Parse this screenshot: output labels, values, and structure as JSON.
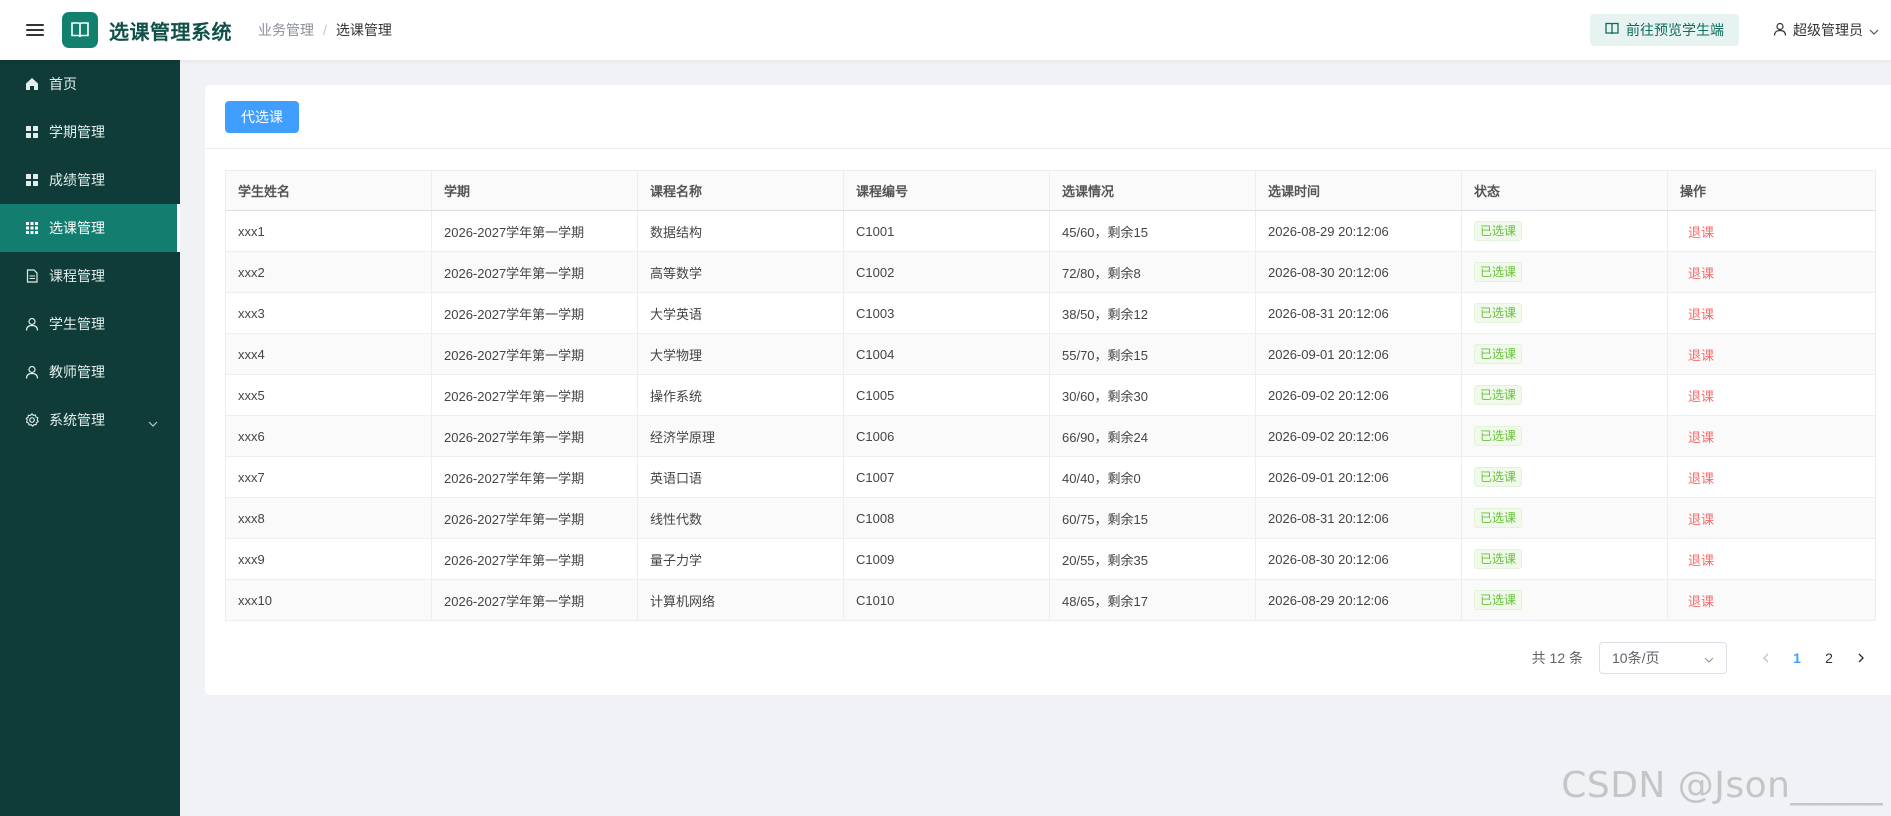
{
  "header": {
    "app_title": "选课管理系统",
    "breadcrumb": [
      "业务管理",
      "选课管理"
    ],
    "preview_label": "前往预览学生端",
    "user_label": "超级管理员"
  },
  "sidebar": {
    "items": [
      {
        "label": "首页",
        "icon": "home-icon"
      },
      {
        "label": "学期管理",
        "icon": "grid-icon"
      },
      {
        "label": "成绩管理",
        "icon": "grid-icon"
      },
      {
        "label": "选课管理",
        "icon": "apps-icon",
        "active": true
      },
      {
        "label": "课程管理",
        "icon": "document-icon"
      },
      {
        "label": "学生管理",
        "icon": "user-icon"
      },
      {
        "label": "教师管理",
        "icon": "user-icon"
      },
      {
        "label": "系统管理",
        "icon": "gear-icon"
      }
    ]
  },
  "toolbar": {
    "proxy_select_label": "代选课"
  },
  "table": {
    "headers": [
      "学生姓名",
      "学期",
      "课程名称",
      "课程编号",
      "选课情况",
      "选课时间",
      "状态",
      "操作"
    ],
    "rows": [
      {
        "name": "xxx1",
        "term": "2026-2027学年第一学期",
        "course": "数据结构",
        "code": "C1001",
        "status_info": "45/60，剩余15",
        "time": "2026-08-29 20:12:06",
        "state": "已选课",
        "action": "退课"
      },
      {
        "name": "xxx2",
        "term": "2026-2027学年第一学期",
        "course": "高等数学",
        "code": "C1002",
        "status_info": "72/80，剩余8",
        "time": "2026-08-30 20:12:06",
        "state": "已选课",
        "action": "退课"
      },
      {
        "name": "xxx3",
        "term": "2026-2027学年第一学期",
        "course": "大学英语",
        "code": "C1003",
        "status_info": "38/50，剩余12",
        "time": "2026-08-31 20:12:06",
        "state": "已选课",
        "action": "退课"
      },
      {
        "name": "xxx4",
        "term": "2026-2027学年第一学期",
        "course": "大学物理",
        "code": "C1004",
        "status_info": "55/70，剩余15",
        "time": "2026-09-01 20:12:06",
        "state": "已选课",
        "action": "退课"
      },
      {
        "name": "xxx5",
        "term": "2026-2027学年第一学期",
        "course": "操作系统",
        "code": "C1005",
        "status_info": "30/60，剩余30",
        "time": "2026-09-02 20:12:06",
        "state": "已选课",
        "action": "退课"
      },
      {
        "name": "xxx6",
        "term": "2026-2027学年第一学期",
        "course": "经济学原理",
        "code": "C1006",
        "status_info": "66/90，剩余24",
        "time": "2026-09-02 20:12:06",
        "state": "已选课",
        "action": "退课"
      },
      {
        "name": "xxx7",
        "term": "2026-2027学年第一学期",
        "course": "英语口语",
        "code": "C1007",
        "status_info": "40/40，剩余0",
        "time": "2026-09-01 20:12:06",
        "state": "已选课",
        "action": "退课"
      },
      {
        "name": "xxx8",
        "term": "2026-2027学年第一学期",
        "course": "线性代数",
        "code": "C1008",
        "status_info": "60/75，剩余15",
        "time": "2026-08-31 20:12:06",
        "state": "已选课",
        "action": "退课"
      },
      {
        "name": "xxx9",
        "term": "2026-2027学年第一学期",
        "course": "量子力学",
        "code": "C1009",
        "status_info": "20/55，剩余35",
        "time": "2026-08-30 20:12:06",
        "state": "已选课",
        "action": "退课"
      },
      {
        "name": "xxx10",
        "term": "2026-2027学年第一学期",
        "course": "计算机网络",
        "code": "C1010",
        "status_info": "48/65，剩余17",
        "time": "2026-08-29 20:12:06",
        "state": "已选课",
        "action": "退课"
      }
    ]
  },
  "pagination": {
    "total_label": "共 12 条",
    "page_size_label": "10条/页",
    "pages": [
      "1",
      "2"
    ],
    "current_page": "1"
  },
  "watermark": "CSDN @Json_____",
  "colors": {
    "sidebar_bg": "#0f3c38",
    "sidebar_active": "#137e70",
    "primary": "#409eff",
    "success": "#67c23a",
    "danger": "#f56c6c"
  }
}
